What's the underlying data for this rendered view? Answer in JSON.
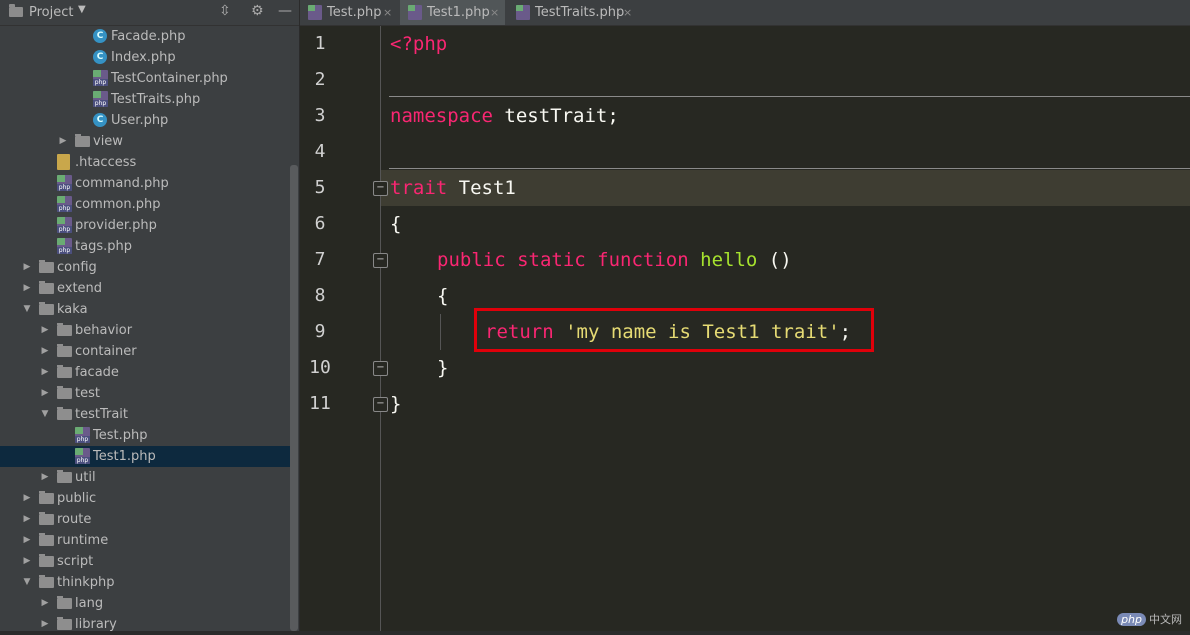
{
  "project": {
    "title": "Project",
    "toolbar_icons": [
      "collapse-icon",
      "gear-icon",
      "minimize-icon"
    ]
  },
  "tree": [
    {
      "label": "Facade.php",
      "type": "class"
    },
    {
      "label": "Index.php",
      "type": "class"
    },
    {
      "label": "TestContainer.php",
      "type": "php"
    },
    {
      "label": "TestTraits.php",
      "type": "php"
    },
    {
      "label": "User.php",
      "type": "class"
    },
    {
      "label": "view",
      "type": "folder"
    },
    {
      "label": ".htaccess",
      "type": "htaccess"
    },
    {
      "label": "command.php",
      "type": "php"
    },
    {
      "label": "common.php",
      "type": "php"
    },
    {
      "label": "provider.php",
      "type": "php"
    },
    {
      "label": "tags.php",
      "type": "php"
    },
    {
      "label": "config",
      "type": "folder"
    },
    {
      "label": "extend",
      "type": "folder"
    },
    {
      "label": "kaka",
      "type": "folder"
    },
    {
      "label": "behavior",
      "type": "folder"
    },
    {
      "label": "container",
      "type": "folder"
    },
    {
      "label": "facade",
      "type": "folder"
    },
    {
      "label": "test",
      "type": "folder"
    },
    {
      "label": "testTrait",
      "type": "folder"
    },
    {
      "label": "Test.php",
      "type": "php"
    },
    {
      "label": "Test1.php",
      "type": "php",
      "selected": true
    },
    {
      "label": "util",
      "type": "folder"
    },
    {
      "label": "public",
      "type": "folder"
    },
    {
      "label": "route",
      "type": "folder"
    },
    {
      "label": "runtime",
      "type": "folder"
    },
    {
      "label": "script",
      "type": "folder"
    },
    {
      "label": "thinkphp",
      "type": "folder"
    },
    {
      "label": "lang",
      "type": "folder"
    },
    {
      "label": "library",
      "type": "folder"
    }
  ],
  "tabs": [
    {
      "label": "Test.php",
      "close": "×"
    },
    {
      "label": "Test1.php",
      "close": "×",
      "active": true
    },
    {
      "label": "TestTraits.php",
      "close": "×"
    }
  ],
  "editor": {
    "line_numbers": [
      "1",
      "2",
      "3",
      "4",
      "5",
      "6",
      "7",
      "8",
      "9",
      "10",
      "11"
    ],
    "line1": "<?php",
    "line3_kw": "namespace",
    "line3_rest": " testTrait;",
    "line5_kw": "trait",
    "line5_rest": " Test1",
    "line6": "{",
    "line7_kw": "public static function",
    "line7_fn": "hello",
    "line7_rest": " ()",
    "line8": "{",
    "line9_kw": "return",
    "line9_str": "'my name is Test1 trait'",
    "line9_end": ";",
    "line10": "}",
    "line11": "}"
  },
  "watermark": {
    "logo": "php",
    "site": "中文网"
  }
}
